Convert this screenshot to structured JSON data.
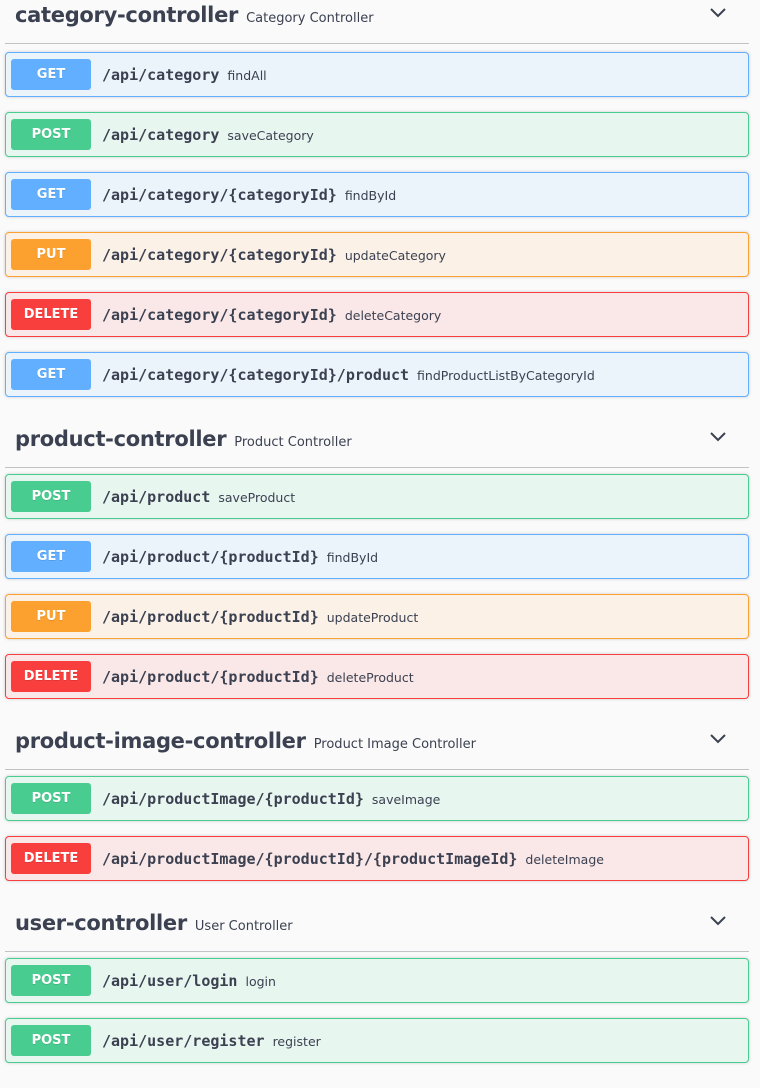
{
  "controllers": [
    {
      "name": "category-controller",
      "description": "Category Controller",
      "operations": [
        {
          "method": "GET",
          "path": "/api/category",
          "summary": "findAll"
        },
        {
          "method": "POST",
          "path": "/api/category",
          "summary": "saveCategory"
        },
        {
          "method": "GET",
          "path": "/api/category/{categoryId}",
          "summary": "findById"
        },
        {
          "method": "PUT",
          "path": "/api/category/{categoryId}",
          "summary": "updateCategory"
        },
        {
          "method": "DELETE",
          "path": "/api/category/{categoryId}",
          "summary": "deleteCategory"
        },
        {
          "method": "GET",
          "path": "/api/category/{categoryId}/product",
          "summary": "findProductListByCategoryId"
        }
      ]
    },
    {
      "name": "product-controller",
      "description": "Product Controller",
      "operations": [
        {
          "method": "POST",
          "path": "/api/product",
          "summary": "saveProduct"
        },
        {
          "method": "GET",
          "path": "/api/product/{productId}",
          "summary": "findById"
        },
        {
          "method": "PUT",
          "path": "/api/product/{productId}",
          "summary": "updateProduct"
        },
        {
          "method": "DELETE",
          "path": "/api/product/{productId}",
          "summary": "deleteProduct"
        }
      ]
    },
    {
      "name": "product-image-controller",
      "description": "Product Image Controller",
      "operations": [
        {
          "method": "POST",
          "path": "/api/productImage/{productId}",
          "summary": "saveImage"
        },
        {
          "method": "DELETE",
          "path": "/api/productImage/{productId}/{productImageId}",
          "summary": "deleteImage"
        }
      ]
    },
    {
      "name": "user-controller",
      "description": "User Controller",
      "operations": [
        {
          "method": "POST",
          "path": "/api/user/login",
          "summary": "login"
        },
        {
          "method": "POST",
          "path": "/api/user/register",
          "summary": "register"
        }
      ]
    }
  ],
  "colors": {
    "get": "#61affe",
    "post": "#49cc90",
    "put": "#fca130",
    "delete": "#f93e3e"
  },
  "icons": {
    "expand": "chevron-down-icon"
  }
}
